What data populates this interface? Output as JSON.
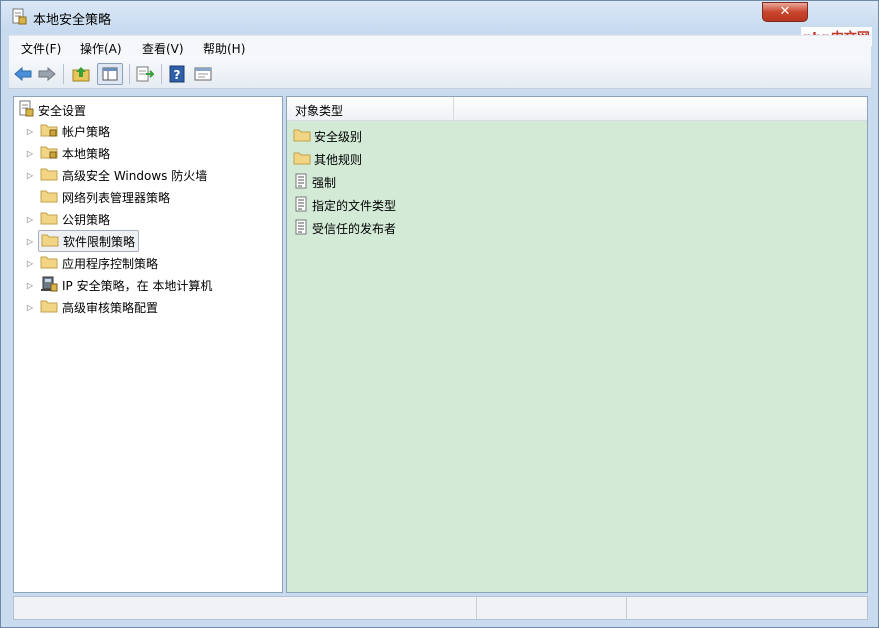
{
  "window": {
    "title": "本地安全策略",
    "watermark": "php中文网"
  },
  "menubar": {
    "items": [
      {
        "label": "文件(F)"
      },
      {
        "label": "操作(A)"
      },
      {
        "label": "查看(V)"
      },
      {
        "label": "帮助(H)"
      }
    ]
  },
  "toolbar": {
    "buttons": [
      "back-icon",
      "forward-icon",
      "up-icon",
      "show-hide-tree-icon",
      "export-list-icon",
      "help-icon",
      "properties-icon"
    ]
  },
  "tree": {
    "root": "安全设置",
    "items": [
      {
        "label": "帐户策略",
        "expandable": true
      },
      {
        "label": "本地策略",
        "expandable": true
      },
      {
        "label": "高级安全 Windows 防火墙",
        "expandable": true
      },
      {
        "label": "网络列表管理器策略",
        "expandable": false
      },
      {
        "label": "公钥策略",
        "expandable": true
      },
      {
        "label": "软件限制策略",
        "expandable": true,
        "selected": true
      },
      {
        "label": "应用程序控制策略",
        "expandable": true
      },
      {
        "label": "IP 安全策略，在 本地计算机",
        "expandable": true
      },
      {
        "label": "高级审核策略配置",
        "expandable": true
      }
    ]
  },
  "list": {
    "column_header": "对象类型",
    "background": "#d3ead6",
    "items": [
      {
        "label": "安全级别",
        "icon": "folder-icon"
      },
      {
        "label": "其他规则",
        "icon": "folder-icon"
      },
      {
        "label": "强制",
        "icon": "policy-icon"
      },
      {
        "label": "指定的文件类型",
        "icon": "policy-icon"
      },
      {
        "label": "受信任的发布者",
        "icon": "policy-icon"
      }
    ]
  }
}
